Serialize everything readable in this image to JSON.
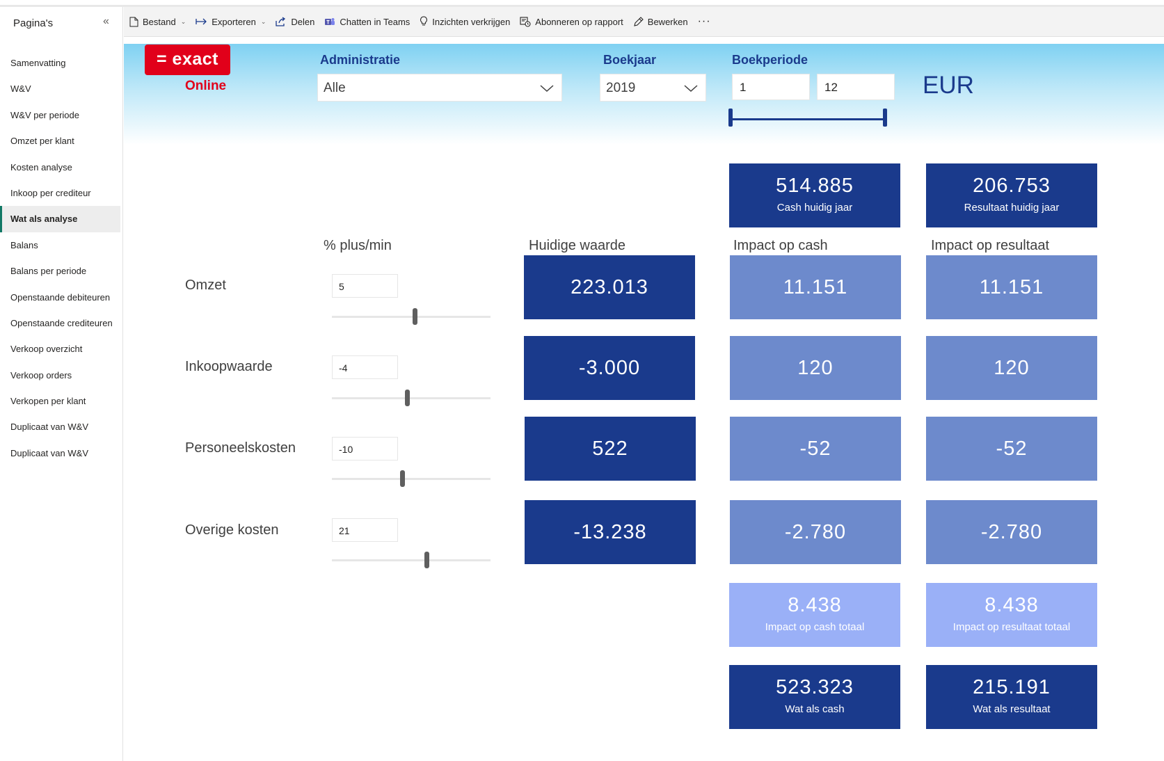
{
  "sidebar": {
    "title": "Pagina's",
    "collapse_icon": "«",
    "items": [
      {
        "label": "Samenvatting"
      },
      {
        "label": "W&V"
      },
      {
        "label": "W&V per periode"
      },
      {
        "label": "Omzet per klant"
      },
      {
        "label": "Kosten analyse"
      },
      {
        "label": "Inkoop per crediteur"
      },
      {
        "label": "Wat als analyse",
        "active": true
      },
      {
        "label": "Balans"
      },
      {
        "label": "Balans per periode"
      },
      {
        "label": "Openstaande debiteuren"
      },
      {
        "label": "Openstaande crediteuren"
      },
      {
        "label": "Verkoop overzicht"
      },
      {
        "label": "Verkoop orders"
      },
      {
        "label": "Verkopen per klant"
      },
      {
        "label": "Duplicaat van W&V"
      },
      {
        "label": "Duplicaat van W&V"
      }
    ]
  },
  "toolbar": {
    "bestand": "Bestand",
    "exporteren": "Exporteren",
    "delen": "Delen",
    "chatten": "Chatten in Teams",
    "inzichten": "Inzichten verkrijgen",
    "abonneren": "Abonneren op rapport",
    "bewerken": "Bewerken",
    "more": "···"
  },
  "brand": {
    "logo_text": "= exact",
    "logo_sub": "Online",
    "color": "#e1001a"
  },
  "filters": {
    "administratie_label": "Administratie",
    "administratie_value": "Alle",
    "boekjaar_label": "Boekjaar",
    "boekjaar_value": "2019",
    "boekperiode_label": "Boekperiode",
    "boekperiode_from": "1",
    "boekperiode_to": "12",
    "currency": "EUR"
  },
  "kpi_top": {
    "cash_value": "514.885",
    "cash_label": "Cash huidig jaar",
    "result_value": "206.753",
    "result_label": "Resultaat huidig jaar"
  },
  "columns": {
    "pct": "% plus/min",
    "current": "Huidige waarde",
    "impact_cash": "Impact op cash",
    "impact_result": "Impact op resultaat"
  },
  "rows": [
    {
      "label": "Omzet",
      "pct": "5",
      "current": "223.013",
      "impact_cash": "11.151",
      "impact_result": "11.151"
    },
    {
      "label": "Inkoopwaarde",
      "pct": "-4",
      "current": "-3.000",
      "impact_cash": "120",
      "impact_result": "120"
    },
    {
      "label": "Personeelskosten",
      "pct": "-10",
      "current": "522",
      "impact_cash": "-52",
      "impact_result": "-52"
    },
    {
      "label": "Overige kosten",
      "pct": "21",
      "current": "-13.238",
      "impact_cash": "-2.780",
      "impact_result": "-2.780"
    }
  ],
  "totals": {
    "impact_cash_value": "8.438",
    "impact_cash_label": "Impact op cash totaal",
    "impact_result_value": "8.438",
    "impact_result_label": "Impact op resultaat totaal",
    "whatif_cash_value": "523.323",
    "whatif_cash_label": "Wat als cash",
    "whatif_result_value": "215.191",
    "whatif_result_label": "Wat als resultaat"
  },
  "colors": {
    "dark_card": "#1a3a8c",
    "mid_card": "#6d8acc",
    "light_card": "#9ab0f7",
    "active_accent": "#117865"
  }
}
